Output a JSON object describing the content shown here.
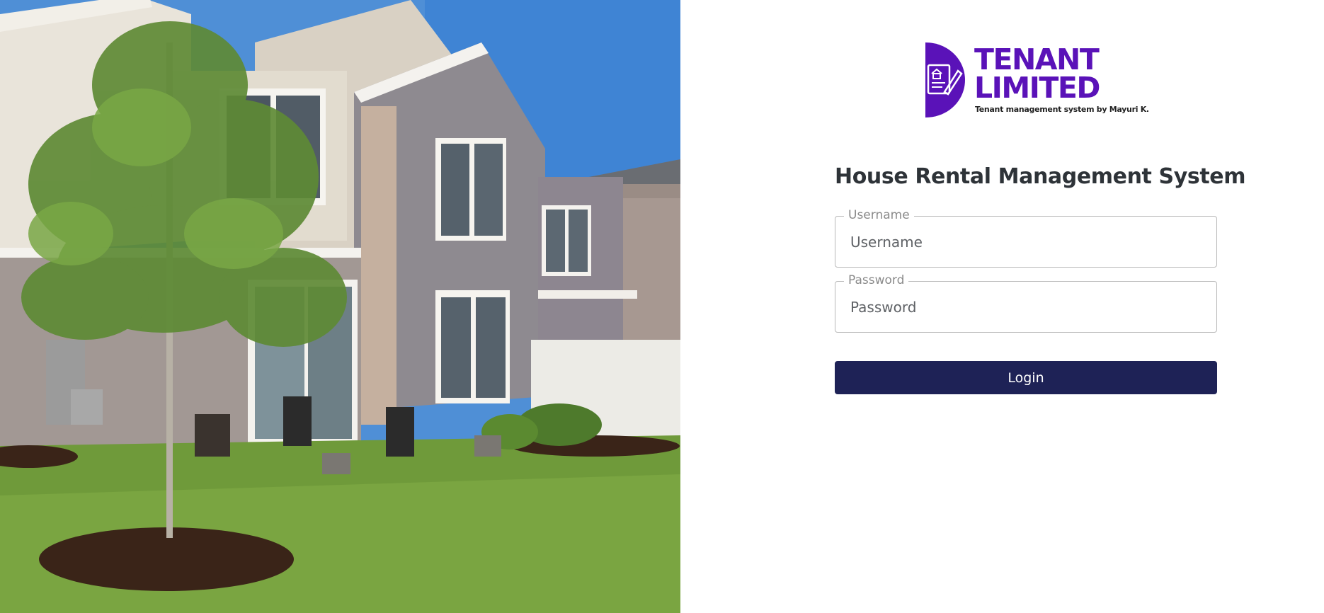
{
  "logo": {
    "word_line1": "TENANT",
    "word_line2": "LIMITED",
    "tagline": "Tenant management system by Mayuri K."
  },
  "title": "House Rental Management System",
  "form": {
    "username": {
      "legend": "Username",
      "placeholder": "Username",
      "value": ""
    },
    "password": {
      "legend": "Password",
      "placeholder": "Password",
      "value": ""
    },
    "login_label": "Login"
  },
  "colors": {
    "brand": "#5a12b8",
    "button": "#1e2256",
    "title": "#2e3338"
  }
}
